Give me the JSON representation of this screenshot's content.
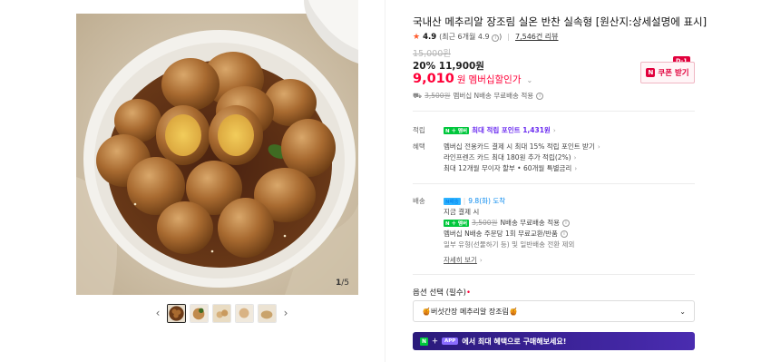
{
  "product": {
    "title": "국내산 메추리알 장조림 실온 반찬 실속형 [원산지:상세설명에 표시]",
    "rating_score": "4.9",
    "rating_detail": "(최근 6개월 4.9",
    "review_count": "7,546건 리뷰",
    "original_price": "15,000원",
    "discount_price": "20% 11,900원",
    "member_price_value": "9,010",
    "member_price_unit": "원",
    "member_price_label": "멤버십할인가",
    "shipping_line_strike": "3,500원",
    "shipping_line_text": "멤버십 N배송 무료배송 적용"
  },
  "coupon": {
    "label": "쿠폰 받기",
    "dday": "D-1"
  },
  "image": {
    "counter_current": "1",
    "counter_total": "/5"
  },
  "benefits": {
    "label_points": "적립",
    "points_text": "최대 적립 포인트 1,431원",
    "label_benefits": "혜택",
    "benefit_lines": [
      "멤버십 전용카드 결제 시 최대 15% 적립 포인트 받기",
      "라인프렌즈 카드 최대 180원 추가 적립(2%)",
      "최대 12개월 무이자 할부 • 60개월 특별금리"
    ]
  },
  "delivery": {
    "label": "배송",
    "badge": "N배송",
    "arrival": "9.8(화) 도착",
    "pay_now": "지금 결제 시",
    "line_strike": "3,500원",
    "line_text": "N배송 무료배송 적용",
    "line2": "멤버십 N배송 주문당 1회 무료교환/반품",
    "line3": "일부 유형(선물하기 등) 및 일반배송 전환 제외",
    "more_link": "자세히 보기"
  },
  "options": {
    "label": "옵션 선택",
    "required": "(필수)",
    "selected": "🍯버섯간장 메추리알 장조림🍯"
  },
  "banner": {
    "app_tag": "APP",
    "text": "에서 최대 혜택으로 구매해보세요!"
  },
  "colors": {
    "accent_red": "#ff0038",
    "naver_green": "#00c73c",
    "banner_purple": "#3c2399"
  }
}
